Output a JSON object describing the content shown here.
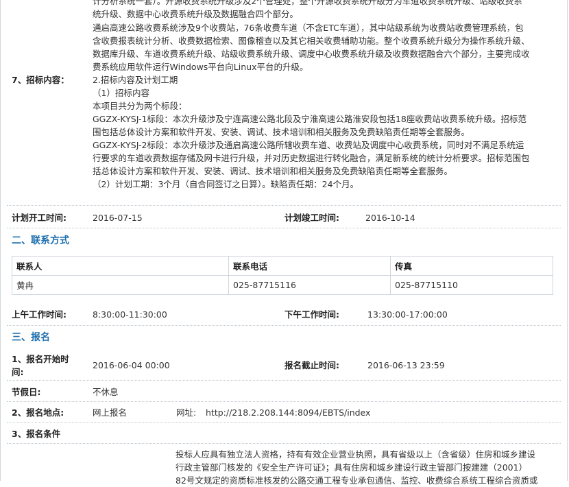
{
  "intro": {
    "lines": [
      "计分析系统一套）。开源收费系统升级涉及2个管理处，整个开源收费系统升级分为车道收费系统升级、站级收费系",
      "统升级、数据中心收费系统升级及数据融合四个部分。",
      "通启高速公路收费系统涉及9个收费站，76条收费车道（不含ETC车道），其中站级系统为收费站收费管理系统，包",
      "含收费报表统计分析、收费数据检索、图像稽查以及其它相关收费辅助功能。整个收费系统升级分为操作系统升级、",
      "数据库升级、车道收费系统升级、站级收费系统升级、调度中心收费系统升级及收费数据融合六个部分，主要完成收",
      "费系统应用软件运行Windows平台向Linux平台的升级。"
    ]
  },
  "bid_content": {
    "label": "7、招标内容：",
    "lines": [
      "2.招标内容及计划工期",
      "（1）招标内容",
      "本项目共分为两个标段：",
      "GGZX-KYSJ-1标段：本次升级涉及宁连高速公路北段及宁淮高速公路淮安段包括18座收费站收费系统升级。招标范",
      "围包括总体设计方案和软件开发、安装、调试、技术培训和相关服务及免费缺陷责任期等全套服务。",
      "GGZX-KYSJ-2标段：本次升级涉及通启高速公路所辖收费车道、收费站及调度中心收费系统，同时对不满足系统运",
      "行要求的车道收费数据存储及网卡进行升级，并对历史数据进行转化融合，满足新系统的统计分析要求。招标范围包",
      "括总体设计方案和软件开发、安装、调试、技术培训和相关服务及免费缺陷责任期等全套服务。",
      "（2）计划工期：3个月（自合同签订之日算）。缺陷责任期：24个月。"
    ]
  },
  "schedule": {
    "start_label": "计划开工时间:",
    "start_value": "2016-07-15",
    "end_label": "计划竣工时间:",
    "end_value": "2016-10-14"
  },
  "contact": {
    "section_title": "二、联系方式",
    "headers": [
      "联系人",
      "联系电话",
      "传真"
    ],
    "row": [
      "黄冉",
      "025-87715116",
      "025-87715110"
    ],
    "am_label": "上午工作时间:",
    "am_value": "8:30:00-11:30:00",
    "pm_label": "下午工作时间:",
    "pm_value": "13:30:00-17:00:00"
  },
  "registration": {
    "section_title": "三、报名",
    "start_label_1": "1、报名开始时",
    "start_label_2": "间:",
    "start_value": "2016-06-04 00:00",
    "deadline_label": "报名截止时间:",
    "deadline_value": "2016-06-13 23:59",
    "holiday_label": "节假日:",
    "holiday_value": "不休息",
    "place_label": "2、报名地点:",
    "place_value": "网上报名",
    "url_label": "网址:",
    "url_value": "http://218.2.208.144:8094/EBTS/index",
    "conditions_label": "3、报名条件",
    "conditions_lines": [
      "投标人应具有独立法人资格，持有有效企业营业执照，具有省级以上（含省级）住房和城乡建设",
      "行政主管部门核发的《安全生产许可证》；具有住房和城乡建设行政主管部门按建建（2001）",
      "82号文规定的资质标准核发的公路交通工程专业承包通信、监控、收费综合系统工程综合资质或"
    ]
  }
}
